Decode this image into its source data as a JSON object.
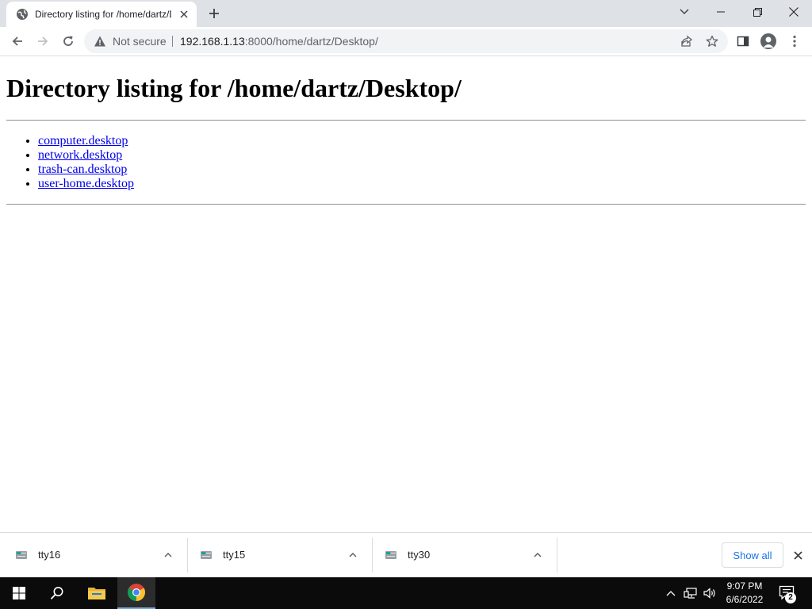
{
  "browser": {
    "tab": {
      "title": "Directory listing for /home/dartz/Desktop/",
      "favicon": "globe-icon"
    },
    "address_bar": {
      "security_label": "Not secure",
      "url_host": "192.168.1.13",
      "url_rest": ":8000/home/dartz/Desktop/"
    }
  },
  "page": {
    "heading": "Directory listing for /home/dartz/Desktop/",
    "files": [
      "computer.desktop",
      "network.desktop",
      "trash-can.desktop",
      "user-home.desktop"
    ],
    "link_color": "#0000ee"
  },
  "downloads": {
    "items": [
      {
        "name": "tty16"
      },
      {
        "name": "tty15"
      },
      {
        "name": "tty30"
      }
    ],
    "show_all_label": "Show all"
  },
  "taskbar": {
    "time": "9:07 PM",
    "date": "6/6/2022",
    "notification_count": "2",
    "accent": "#7aa7d8"
  }
}
